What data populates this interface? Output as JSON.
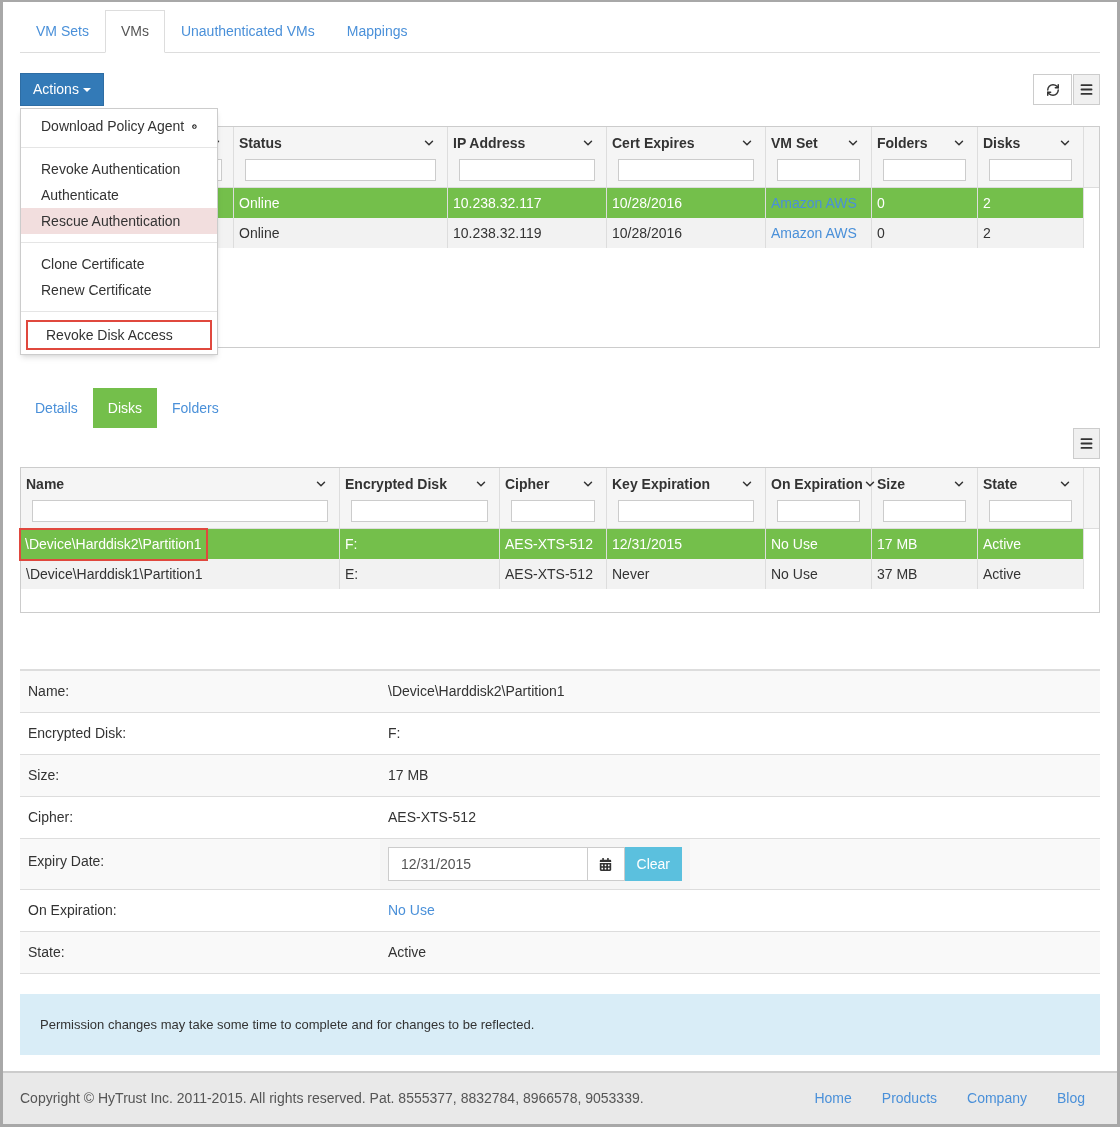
{
  "tabs": [
    {
      "label": "VM Sets",
      "selected": false
    },
    {
      "label": "VMs",
      "selected": true
    },
    {
      "label": "Unauthenticated VMs",
      "selected": false
    },
    {
      "label": "Mappings",
      "selected": false
    }
  ],
  "actions_button": {
    "label": "Actions"
  },
  "actions_menu": {
    "groups": [
      [
        {
          "label": "Download Policy Agent",
          "kind": "download",
          "selected": false,
          "outlined": false
        }
      ],
      [
        {
          "label": "Revoke Authentication",
          "kind": "plain",
          "selected": false,
          "outlined": false
        },
        {
          "label": "Authenticate",
          "kind": "plain",
          "selected": false,
          "outlined": false
        },
        {
          "label": "Rescue Authentication",
          "kind": "plain",
          "selected": true,
          "outlined": false
        }
      ],
      [
        {
          "label": "Clone Certificate",
          "kind": "plain",
          "selected": false,
          "outlined": false
        },
        {
          "label": "Renew Certificate",
          "kind": "plain",
          "selected": false,
          "outlined": false
        }
      ],
      [
        {
          "label": "Revoke Disk Access",
          "kind": "plain",
          "selected": false,
          "outlined": true
        }
      ]
    ]
  },
  "vm_table": {
    "columns": [
      {
        "label": "Status",
        "kind": "text"
      },
      {
        "label": "IP Address",
        "kind": "text"
      },
      {
        "label": "Cert Expires",
        "kind": "text"
      },
      {
        "label": "VM Set",
        "kind": "link"
      },
      {
        "label": "Folders",
        "kind": "text"
      },
      {
        "label": "Disks",
        "kind": "text"
      }
    ],
    "rows": [
      {
        "selected": true,
        "cells": [
          "Online",
          "10.238.32.117",
          "10/28/2016",
          "Amazon AWS",
          "0",
          "2"
        ]
      },
      {
        "selected": false,
        "cells": [
          "Online",
          "10.238.32.119",
          "10/28/2016",
          "Amazon AWS",
          "0",
          "2"
        ]
      }
    ]
  },
  "detail_tabs": [
    {
      "label": "Details",
      "selected": false
    },
    {
      "label": "Disks",
      "selected": true
    },
    {
      "label": "Folders",
      "selected": false
    }
  ],
  "disk_table": {
    "columns": [
      {
        "label": "Name"
      },
      {
        "label": "Encrypted Disk"
      },
      {
        "label": "Cipher"
      },
      {
        "label": "Key Expiration"
      },
      {
        "label": "On Expiration"
      },
      {
        "label": "Size"
      },
      {
        "label": "State"
      }
    ],
    "rows": [
      {
        "selected": true,
        "name_outlined": true,
        "cells": [
          "\\Device\\Harddisk2\\Partition1",
          "F:",
          "AES-XTS-512",
          "12/31/2015",
          "No Use",
          "17 MB",
          "Active"
        ]
      },
      {
        "selected": false,
        "name_outlined": false,
        "cells": [
          "\\Device\\Harddisk1\\Partition1",
          "E:",
          "AES-XTS-512",
          "Never",
          "No Use",
          "37 MB",
          "Active"
        ]
      }
    ]
  },
  "details": [
    {
      "label": "Name:",
      "kind": "text",
      "value": "\\Device\\Harddisk2\\Partition1"
    },
    {
      "label": "Encrypted Disk:",
      "kind": "text",
      "value": "F:"
    },
    {
      "label": "Size:",
      "kind": "text",
      "value": "17 MB"
    },
    {
      "label": "Cipher:",
      "kind": "text",
      "value": "AES-XTS-512"
    },
    {
      "label": "Expiry Date:",
      "kind": "date",
      "value": "12/31/2015",
      "button": "Clear"
    },
    {
      "label": "On Expiration:",
      "kind": "link",
      "value": "No Use"
    },
    {
      "label": "State:",
      "kind": "text",
      "value": "Active"
    }
  ],
  "notice": "Permission changes may take some time to complete and for changes to be reflected.",
  "footer": {
    "copyright": "Copyright © HyTrust Inc. 2011-2015. All rights reserved. Pat. 8555377, 8832784, 8966578, 9053339.",
    "links": [
      "Home",
      "Products",
      "Company",
      "Blog"
    ]
  }
}
